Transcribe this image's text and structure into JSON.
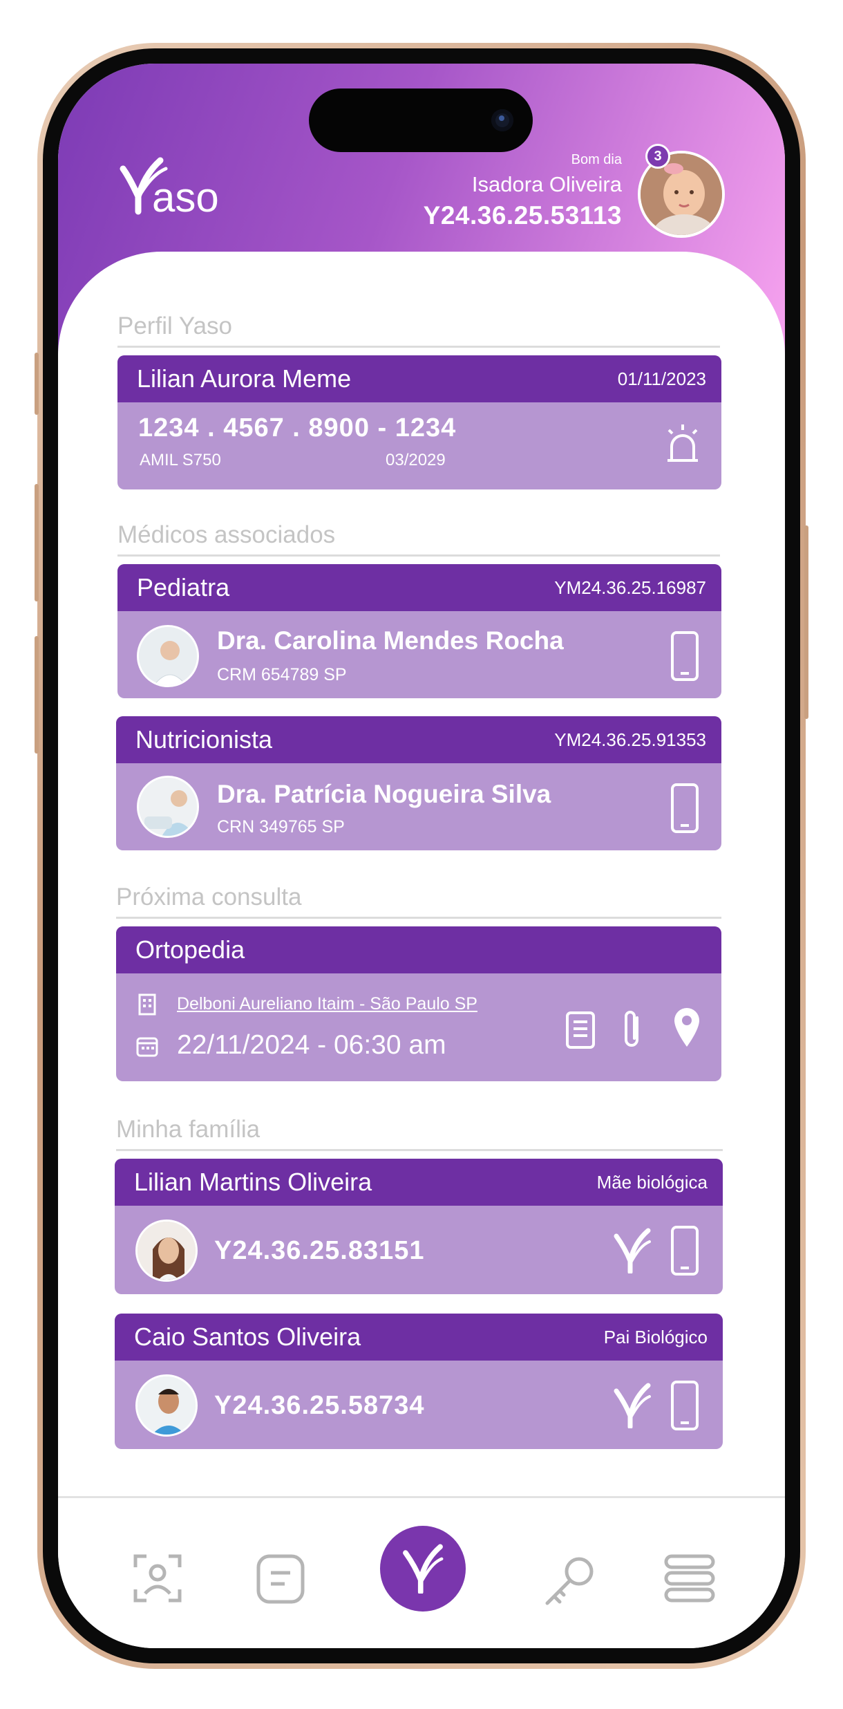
{
  "header": {
    "logo_text": "Yaso",
    "greeting": "Bom dia",
    "user_name": "Isadora Oliveira",
    "user_id": "Y24.36.25.53113",
    "notification_count": "3"
  },
  "profile": {
    "section_title": "Perfil Yaso",
    "name": "Lilian Aurora Meme",
    "date": "01/11/2023",
    "card_number": "1234 . 4567 . 8900 - 1234",
    "plan": "AMIL S750",
    "expiry": "03/2029",
    "icon": "alarm-siren-icon"
  },
  "doctors": {
    "section_title": "Médicos associados",
    "items": [
      {
        "specialty": "Pediatra",
        "code": "YM24.36.25.16987",
        "name": "Dra. Carolina Mendes Rocha",
        "registry": "CRM 654789 SP",
        "icon": "phone-icon"
      },
      {
        "specialty": "Nutricionista",
        "code": "YM24.36.25.91353",
        "name": "Dra. Patrícia Nogueira Silva",
        "registry": "CRN 349765 SP",
        "icon": "phone-icon"
      }
    ]
  },
  "appointment": {
    "section_title": "Próxima consulta",
    "specialty": "Ortopedia",
    "location": "Delboni Aureliano Itaim - São Paulo SP",
    "datetime": "22/11/2024 - 06:30 am",
    "icons": [
      "document-icon",
      "paperclip-icon",
      "map-pin-icon"
    ]
  },
  "family": {
    "section_title": "Minha família",
    "members": [
      {
        "name": "Lilian Martins Oliveira",
        "relation": "Mãe biológica",
        "id": "Y24.36.25.83151"
      },
      {
        "name": "Caio Santos Oliveira",
        "relation": "Pai Biológico",
        "id": "Y24.36.25.58734"
      }
    ]
  },
  "nav": {
    "items": [
      "face-scan-icon",
      "chat-card-icon",
      "yaso-home-icon",
      "key-icon",
      "menu-stack-icon"
    ]
  },
  "colors": {
    "accent": "#6e2fa3",
    "card_bg": "#b696d1",
    "header_start": "#7d3bb5",
    "header_end": "#f7a3ef"
  }
}
